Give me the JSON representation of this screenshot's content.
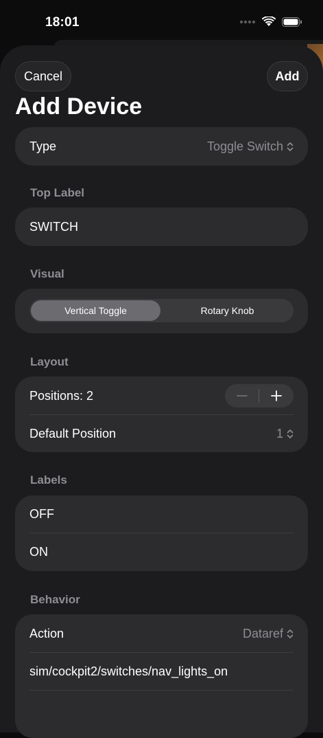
{
  "status_bar": {
    "time": "18:01"
  },
  "header": {
    "cancel_label": "Cancel",
    "add_label": "Add",
    "title": "Add Device"
  },
  "type_row": {
    "label": "Type",
    "value": "Toggle Switch"
  },
  "top_label": {
    "section": "Top Label",
    "value": "SWITCH"
  },
  "visual": {
    "section": "Visual",
    "options": [
      "Vertical Toggle",
      "Rotary Knob"
    ],
    "selected": "Vertical Toggle"
  },
  "layout": {
    "section": "Layout",
    "positions_label": "Positions: 2",
    "default_label": "Default Position",
    "default_value": "1"
  },
  "labels": {
    "section": "Labels",
    "items": [
      "OFF",
      "ON"
    ]
  },
  "behavior": {
    "section": "Behavior",
    "action_label": "Action",
    "action_value": "Dataref",
    "dataref": "sim/cockpit2/switches/nav_lights_on"
  },
  "colors": {
    "background": "#1c1c1e",
    "card": "#2c2c2e",
    "secondary_text": "#8e8e93"
  }
}
